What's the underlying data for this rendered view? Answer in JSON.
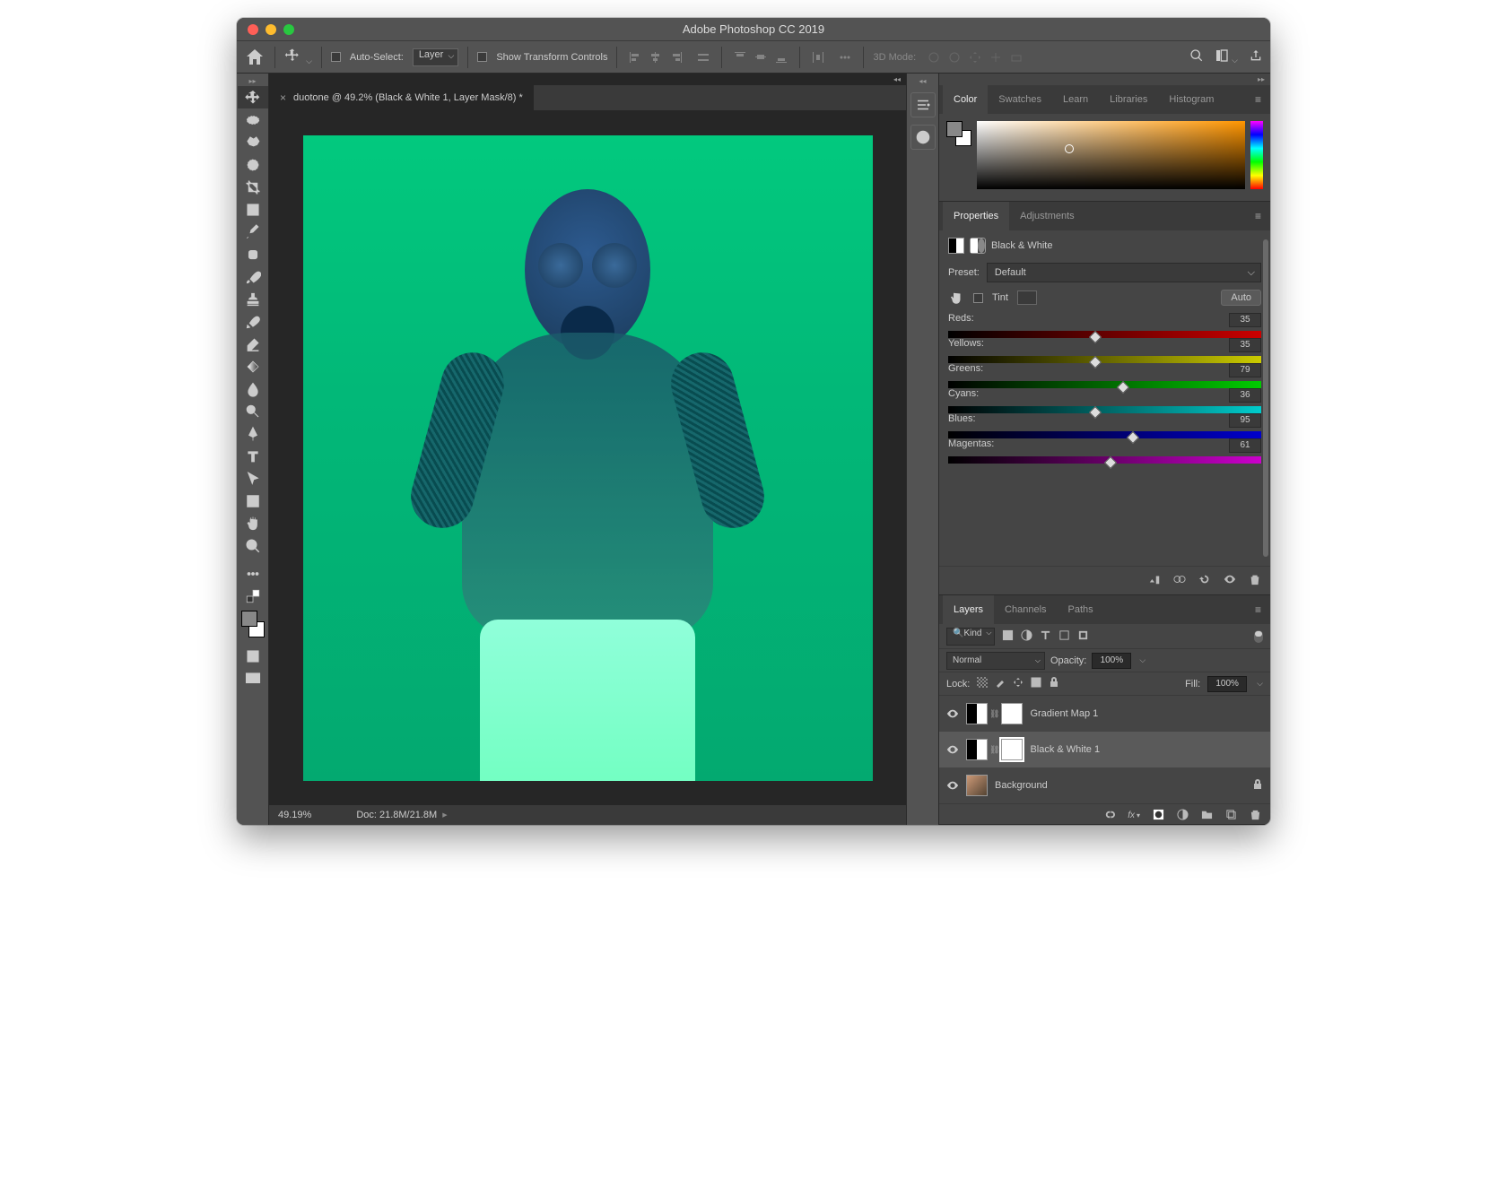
{
  "title": "Adobe Photoshop CC 2019",
  "optbar": {
    "auto_select": "Auto-Select:",
    "layer_dd": "Layer",
    "show_transform": "Show Transform Controls",
    "mode_3d": "3D Mode:"
  },
  "doc": {
    "tab_label": "duotone @ 49.2% (Black & White 1, Layer Mask/8) *",
    "zoom": "49.19%",
    "doc_size": "Doc: 21.8M/21.8M"
  },
  "panels": {
    "color_tabs": [
      "Color",
      "Swatches",
      "Learn",
      "Libraries",
      "Histogram"
    ],
    "props_tabs": [
      "Properties",
      "Adjustments"
    ],
    "layers_tabs": [
      "Layers",
      "Channels",
      "Paths"
    ]
  },
  "props": {
    "adj_name": "Black & White",
    "preset_label": "Preset:",
    "preset_value": "Default",
    "tint_label": "Tint",
    "auto_label": "Auto",
    "sliders": [
      {
        "label": "Reds:",
        "value": "35",
        "pct": 47,
        "grad": "g-reds"
      },
      {
        "label": "Yellows:",
        "value": "35",
        "pct": 47,
        "grad": "g-yellows"
      },
      {
        "label": "Greens:",
        "value": "79",
        "pct": 56,
        "grad": "g-greens"
      },
      {
        "label": "Cyans:",
        "value": "36",
        "pct": 47,
        "grad": "g-cyans"
      },
      {
        "label": "Blues:",
        "value": "95",
        "pct": 59,
        "grad": "g-blues"
      },
      {
        "label": "Magentas:",
        "value": "61",
        "pct": 52,
        "grad": "g-magentas"
      }
    ]
  },
  "layers": {
    "kind_search": "🔍Kind",
    "blend_mode": "Normal",
    "opacity_label": "Opacity:",
    "opacity_val": "100%",
    "lock_label": "Lock:",
    "fill_label": "Fill:",
    "fill_val": "100%",
    "items": [
      {
        "name": "Gradient Map 1",
        "sel": false,
        "mask": true,
        "bg": false
      },
      {
        "name": "Black & White 1",
        "sel": true,
        "mask": true,
        "bg": false
      },
      {
        "name": "Background",
        "sel": false,
        "mask": false,
        "bg": true
      }
    ],
    "fx_label": "fx"
  }
}
